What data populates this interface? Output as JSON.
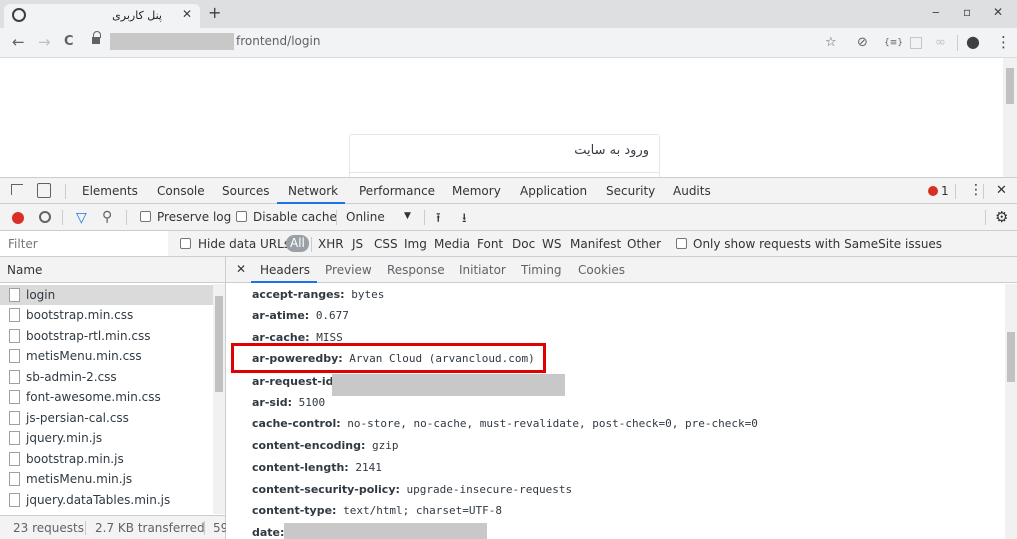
{
  "browser": {
    "tab_title": "پنل کاربری",
    "tab_close": "✕",
    "new_tab": "+",
    "minimize": "‒",
    "maximize": "▫",
    "close": "✕",
    "back": "←",
    "forward": "→",
    "reload": "C",
    "url_suffix": "frontend/login",
    "profile": "●",
    "menu": "⋮"
  },
  "page": {
    "card_header": "ورود به سایت"
  },
  "devtools": {
    "tabs": [
      "Elements",
      "Console",
      "Sources",
      "Network",
      "Performance",
      "Memory",
      "Application",
      "Security",
      "Audits"
    ],
    "active_tab": "Network",
    "error_count": "1",
    "close": "✕",
    "more": "⋮",
    "network_toolbar": {
      "preserve_log": "Preserve log",
      "disable_cache": "Disable cache",
      "throttling": "Online",
      "settings": "⚙"
    },
    "filter": {
      "placeholder": "Filter",
      "hide_data_urls": "Hide data URLs",
      "types": [
        "All",
        "XHR",
        "JS",
        "CSS",
        "Img",
        "Media",
        "Font",
        "Doc",
        "WS",
        "Manifest",
        "Other"
      ],
      "samesite": "Only show requests with SameSite issues"
    },
    "name_column": {
      "header": "Name",
      "requests": [
        "login",
        "bootstrap.min.css",
        "bootstrap-rtl.min.css",
        "metisMenu.min.css",
        "sb-admin-2.css",
        "font-awesome.min.css",
        "js-persian-cal.css",
        "jquery.min.js",
        "bootstrap.min.js",
        "metisMenu.min.js",
        "jquery.dataTables.min.js"
      ],
      "selected": "login"
    },
    "status": {
      "requests": "23 requests",
      "transferred": "2.7 KB transferred",
      "trailing": "59"
    },
    "detail_tabs": [
      "Headers",
      "Preview",
      "Response",
      "Initiator",
      "Timing",
      "Cookies"
    ],
    "detail_close": "✕",
    "active_detail_tab": "Headers",
    "headers": [
      {
        "key": "accept-ranges:",
        "value": "bytes"
      },
      {
        "key": "ar-atime:",
        "value": "0.677"
      },
      {
        "key": "ar-cache:",
        "value": "MISS"
      },
      {
        "key": "ar-poweredby:",
        "value": "Arvan Cloud (arvancloud.com)"
      },
      {
        "key": "ar-request-id:",
        "value": ""
      },
      {
        "key": "ar-sid:",
        "value": "5100"
      },
      {
        "key": "cache-control:",
        "value": "no-store, no-cache, must-revalidate, post-check=0, pre-check=0"
      },
      {
        "key": "content-encoding:",
        "value": "gzip"
      },
      {
        "key": "content-length:",
        "value": "2141"
      },
      {
        "key": "content-security-policy:",
        "value": "upgrade-insecure-requests"
      },
      {
        "key": "content-type:",
        "value": "text/html; charset=UTF-8"
      },
      {
        "key": "date:",
        "value": ""
      }
    ],
    "colors": {
      "highlight_box": "#e00000",
      "record": "#d93025",
      "filter_active": "#1a73e8"
    }
  }
}
